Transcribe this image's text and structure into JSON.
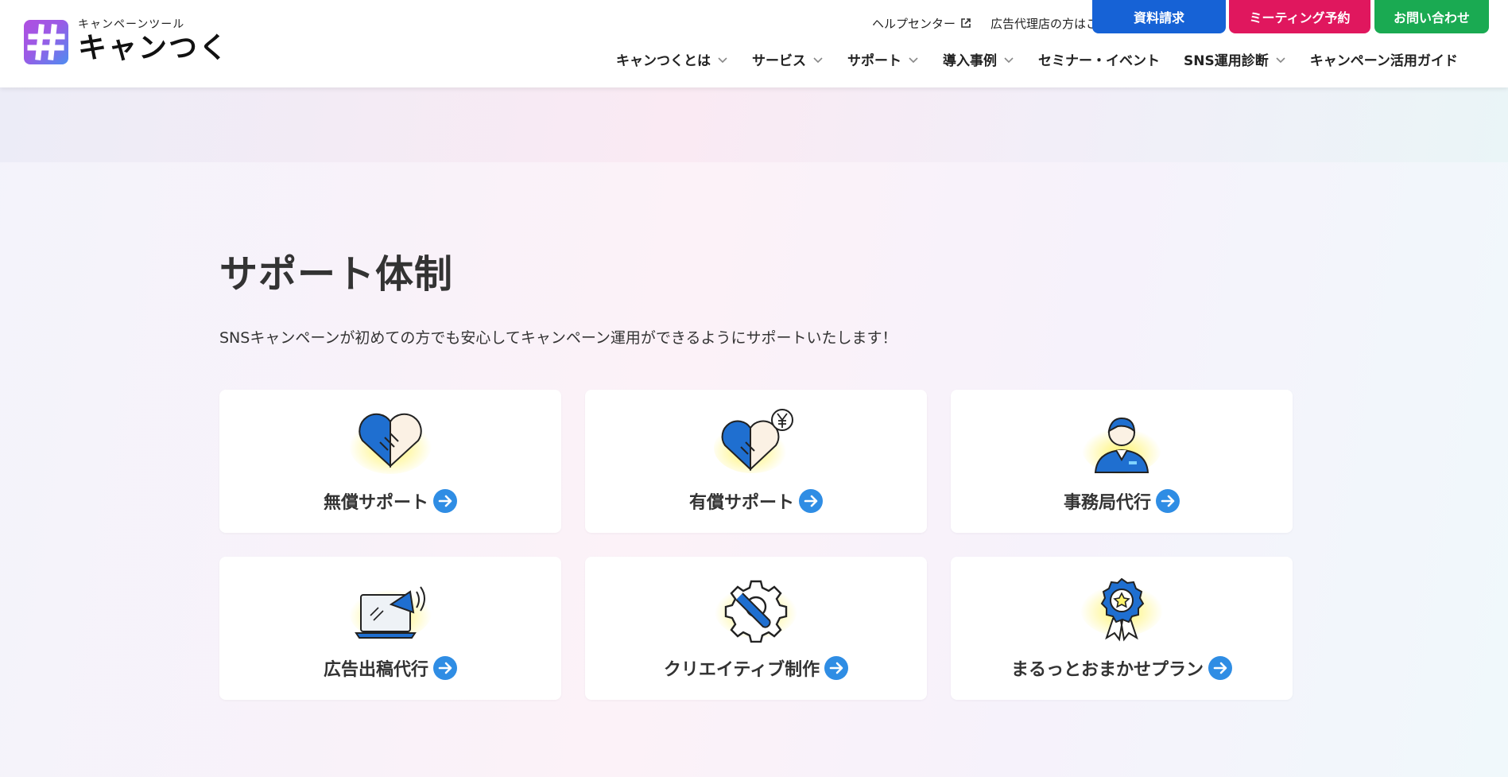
{
  "header": {
    "logo": {
      "sub": "キャンペーンツール",
      "main": "キャンつく"
    },
    "util": {
      "help_center": "ヘルプセンター",
      "agency": "広告代理店の方はこちら"
    },
    "cta": {
      "document": "資料請求",
      "meeting": "ミーティング予約",
      "contact": "お問い合わせ"
    },
    "nav": [
      {
        "label": "キャンつくとは",
        "dropdown": true
      },
      {
        "label": "サービス",
        "dropdown": true
      },
      {
        "label": "サポート",
        "dropdown": true
      },
      {
        "label": "導入事例",
        "dropdown": true
      },
      {
        "label": "セミナー・イベント",
        "dropdown": false
      },
      {
        "label": "SNS運用診断",
        "dropdown": true
      },
      {
        "label": "キャンペーン活用ガイド",
        "dropdown": false
      }
    ]
  },
  "section": {
    "title": "サポート体制",
    "lead": "SNSキャンペーンが初めての方でも安心してキャンペーン運用ができるようにサポートいたします！"
  },
  "cards": [
    {
      "label": "無償サポート",
      "icon": "handshake-icon"
    },
    {
      "label": "有償サポート",
      "icon": "handshake-yen-icon"
    },
    {
      "label": "事務局代行",
      "icon": "staff-person-icon"
    },
    {
      "label": "広告出稿代行",
      "icon": "laptop-megaphone-icon"
    },
    {
      "label": "クリエイティブ制作",
      "icon": "gear-wrench-icon"
    },
    {
      "label": "まるっとおまかせプラン",
      "icon": "award-badge-icon"
    }
  ],
  "colors": {
    "brand_blue": "#1662d6",
    "meeting_pink": "#e0175e",
    "contact_green": "#1aaa52",
    "arrow_blue": "#2f8de4",
    "icon_blue": "#1f6fd0",
    "icon_glow": "#fff36b"
  }
}
